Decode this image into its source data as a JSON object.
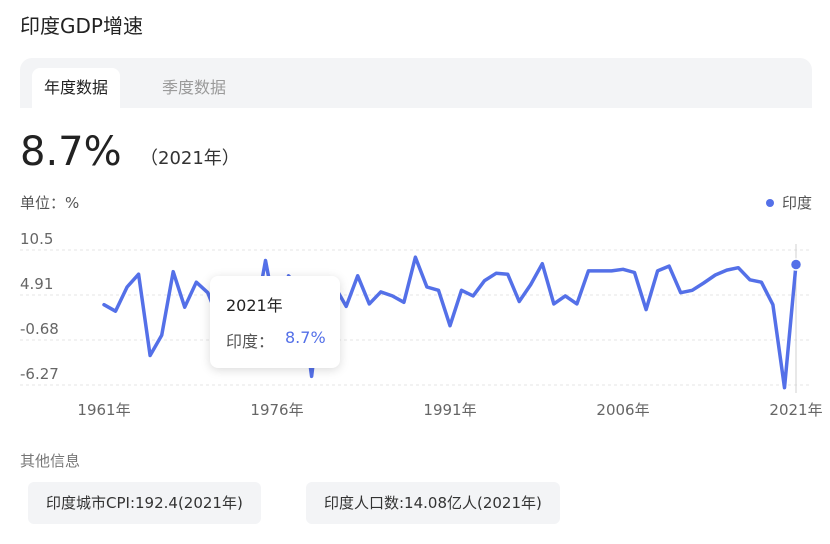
{
  "page": {
    "title": "印度GDP增速"
  },
  "tabs": [
    {
      "label": "年度数据",
      "active": true
    },
    {
      "label": "季度数据",
      "active": false
    }
  ],
  "summary": {
    "value": "8.7%",
    "year": "（2021年）"
  },
  "unit_label": "单位：%",
  "legend_label": "印度",
  "colors": {
    "accent": "#5470e8",
    "grid": "#e6e6e6"
  },
  "tooltip": {
    "year": "2021年",
    "label": "印度：",
    "value": "8.7%"
  },
  "other_info": {
    "title": "其他信息",
    "chips": [
      {
        "label": "印度城市CPI:192.4(2021年)"
      },
      {
        "label": "印度人口数:14.08亿人(2021年)"
      }
    ]
  },
  "chart_data": {
    "type": "line",
    "ylim": [
      -6.27,
      10.5
    ],
    "yticks": [
      "10.5",
      "4.91",
      "-0.68",
      "-6.27"
    ],
    "xticks": [
      "1961年",
      "1976年",
      "1991年",
      "2006年",
      "2021年"
    ],
    "grid": true,
    "legend_position": "top-right",
    "series": [
      {
        "name": "印度",
        "x": [
          1961,
          1962,
          1963,
          1964,
          1965,
          1966,
          1967,
          1968,
          1969,
          1970,
          1971,
          1972,
          1973,
          1974,
          1975,
          1976,
          1977,
          1978,
          1979,
          1980,
          1981,
          1982,
          1983,
          1984,
          1985,
          1986,
          1987,
          1988,
          1989,
          1990,
          1991,
          1992,
          1993,
          1994,
          1995,
          1996,
          1997,
          1998,
          1999,
          2000,
          2001,
          2002,
          2003,
          2004,
          2005,
          2006,
          2007,
          2008,
          2009,
          2010,
          2011,
          2012,
          2013,
          2014,
          2015,
          2016,
          2017,
          2018,
          2019,
          2020,
          2021
        ],
        "y": [
          3.7,
          2.9,
          5.9,
          7.5,
          -2.6,
          -0.1,
          7.8,
          3.4,
          6.5,
          5.2,
          1.6,
          -0.6,
          3.3,
          1.2,
          9.2,
          1.7,
          7.3,
          5.7,
          -5.2,
          6.7,
          6.0,
          3.5,
          7.3,
          3.8,
          5.3,
          4.8,
          4.0,
          9.6,
          5.9,
          5.5,
          1.1,
          5.5,
          4.8,
          6.7,
          7.6,
          7.5,
          4.1,
          6.2,
          8.8,
          3.8,
          4.8,
          3.8,
          7.9,
          7.9,
          7.9,
          8.1,
          7.7,
          3.1,
          7.9,
          8.5,
          5.2,
          5.5,
          6.4,
          7.4,
          8.0,
          8.3,
          6.8,
          6.5,
          3.7,
          -6.6,
          8.7
        ]
      }
    ],
    "highlight": {
      "x": 2021,
      "y": 8.7
    }
  }
}
